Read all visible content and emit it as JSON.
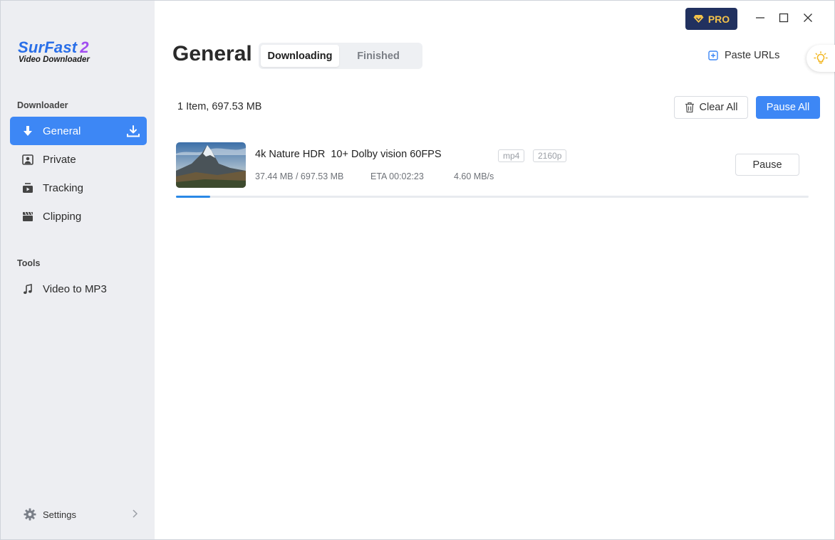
{
  "app": {
    "logo_title": "SurFast",
    "logo_number": "2",
    "logo_subtitle": "Video Downloader"
  },
  "sidebar": {
    "section_downloader": "Downloader",
    "items": [
      {
        "label": "General",
        "icon": "download-arrow-icon",
        "active": true
      },
      {
        "label": "Private",
        "icon": "private-user-icon"
      },
      {
        "label": "Tracking",
        "icon": "tracking-video-icon"
      },
      {
        "label": "Clipping",
        "icon": "clapperboard-icon"
      }
    ],
    "section_tools": "Tools",
    "tools": [
      {
        "label": "Video to MP3",
        "icon": "music-note-icon"
      }
    ],
    "settings_label": "Settings"
  },
  "header": {
    "page_title": "General",
    "tabs": [
      {
        "label": "Downloading",
        "active": true
      },
      {
        "label": "Finished"
      }
    ],
    "pro_label": "PRO",
    "paste_urls_label": "Paste URLs"
  },
  "toolbar": {
    "summary": "1 Item, 697.53 MB",
    "clear_all_label": "Clear All",
    "pause_all_label": "Pause All"
  },
  "downloads": [
    {
      "title": "4k Nature HDR  10+ Dolby vision 60FPS",
      "format": "mp4",
      "resolution": "2160p",
      "size_progress": "37.44 MB / 697.53 MB",
      "eta": "ETA 00:02:23",
      "speed": "4.60 MB/s",
      "action_label": "Pause",
      "progress_fraction": 0.0537
    }
  ],
  "colors": {
    "accent": "#3d87f5",
    "sidebar_bg": "#edeef2",
    "pro_bg": "#21315f",
    "pro_text": "#f3c24a",
    "progress": "#2a88e6"
  }
}
